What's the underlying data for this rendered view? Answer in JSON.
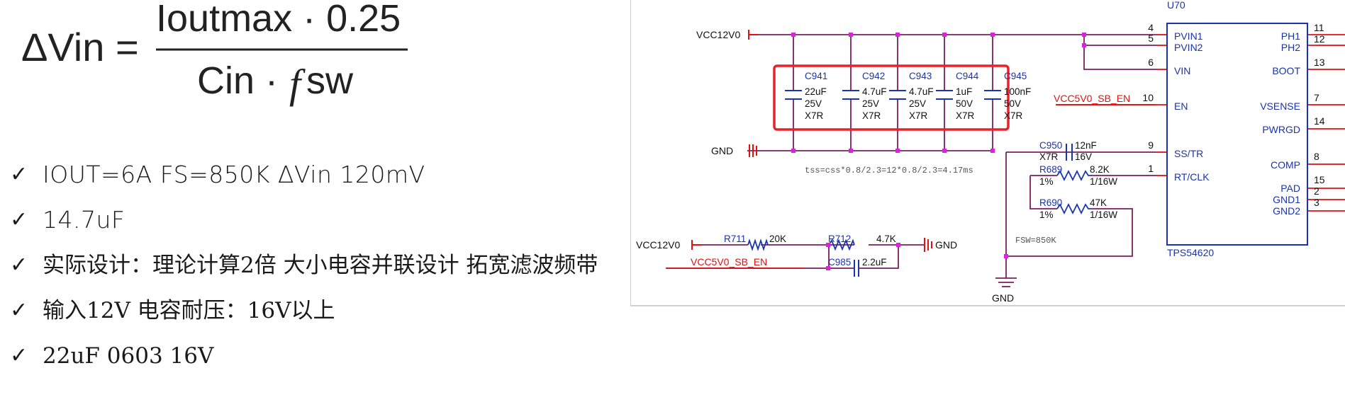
{
  "formula": {
    "lhs": "ΔVin",
    "equals": "=",
    "numerator": "Ioutmax · 0.25",
    "denominator_left": "Cin · ",
    "denominator_f": "f",
    "denominator_right": "sw"
  },
  "bullets": [
    {
      "text": "IOUT=6A   FS=850K  ΔVin   120mV"
    },
    {
      "text": "14.7uF"
    },
    {
      "text": "实际设计：理论计算2倍   大小电容并联设计 拓宽滤波频带"
    },
    {
      "text": "输入12V 电容耐压：16V以上"
    },
    {
      "text": "22uF 0603 16V"
    }
  ],
  "check_glyph": "✓",
  "schematic": {
    "vcc_top": "VCC12V0",
    "gnd_top": "GND",
    "caps": [
      {
        "ref": "C941",
        "val": "22uF",
        "volt": "25V",
        "diel": "X7R"
      },
      {
        "ref": "C942",
        "val": "4.7uF",
        "volt": "25V",
        "diel": "X7R"
      },
      {
        "ref": "C943",
        "val": "4.7uF",
        "volt": "25V",
        "diel": "X7R"
      },
      {
        "ref": "C944",
        "val": "1uF",
        "volt": "50V",
        "diel": "X7R"
      },
      {
        "ref": "C945",
        "val": "100nF",
        "volt": "50V",
        "diel": "X7R"
      }
    ],
    "en_net": "VCC5V0_SB_EN",
    "tss_note": "tss=css*0.8/2.3=12*0.8/2.3=4.17ms",
    "c950": {
      "ref": "C950",
      "val": "12nF",
      "diel": "X7R",
      "volt": "16V"
    },
    "r689": {
      "ref": "R689",
      "val": "8.2K",
      "tol": "1%",
      "pwr": "1/16W"
    },
    "r690": {
      "ref": "R690",
      "val": "47K",
      "tol": "1%",
      "pwr": "1/16W"
    },
    "fsw_note": "FSW=850K",
    "gnd_bottom": "GND",
    "vcc_bottom": "VCC12V0",
    "r711": {
      "ref": "R711",
      "val": "20K"
    },
    "r712": {
      "ref": "R712",
      "val": "4.7K"
    },
    "gnd_right": "GND",
    "en_net_bottom": "VCC5V0_SB_EN",
    "c985": {
      "ref": "C985",
      "val": "2.2uF"
    },
    "ic": {
      "ref": "U70",
      "part": "TPS54620",
      "left_pins": [
        {
          "num": "4",
          "name": "PVIN1"
        },
        {
          "num": "5",
          "name": "PVIN2"
        },
        {
          "num": "6",
          "name": "VIN"
        },
        {
          "num": "10",
          "name": "EN"
        },
        {
          "num": "9",
          "name": "SS/TR"
        },
        {
          "num": "1",
          "name": "RT/CLK"
        }
      ],
      "right_pins": [
        {
          "num": "11",
          "name": "PH1"
        },
        {
          "num": "12",
          "name": "PH2"
        },
        {
          "num": "13",
          "name": "BOOT"
        },
        {
          "num": "7",
          "name": "VSENSE"
        },
        {
          "num": "14",
          "name": "PWRGD"
        },
        {
          "num": "8",
          "name": "COMP"
        },
        {
          "num": "15",
          "name": "PAD"
        },
        {
          "num": "2",
          "name": "GND1"
        },
        {
          "num": "3",
          "name": "GND2"
        }
      ]
    }
  },
  "colors": {
    "wire": "#7a1f5c",
    "junction": "#e020e0",
    "pin": "#e01010",
    "ref_text": "#1a33b0",
    "net_red": "#e01010",
    "highlight": "#e8222a",
    "symbol": "#1a33b0",
    "text": "#111111"
  }
}
